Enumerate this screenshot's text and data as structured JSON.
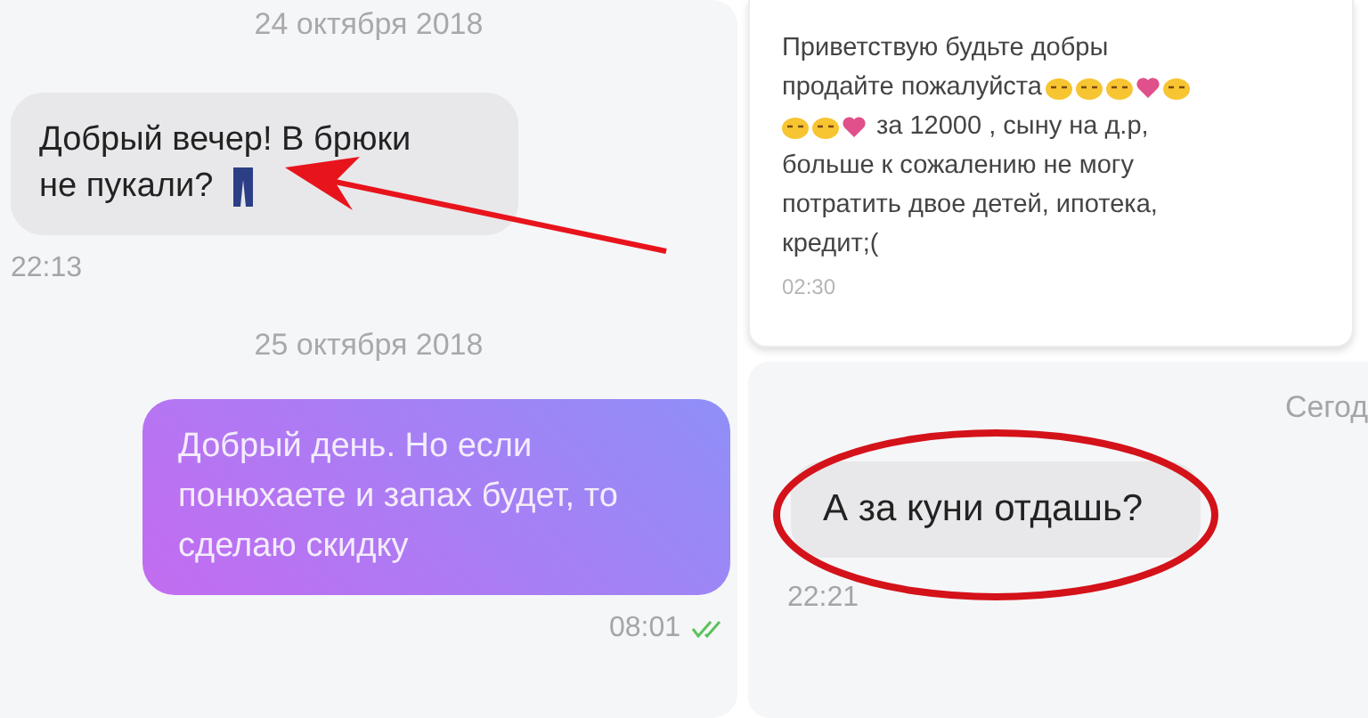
{
  "left_chat": {
    "items": [
      {
        "kind": "date",
        "text": "24 октября 2018"
      },
      {
        "kind": "incoming",
        "lines": [
          "Добрый вечер! В брюки",
          "не пукали?"
        ],
        "emoji": [
          {
            "kind": "trousers"
          }
        ],
        "time": "22:13",
        "annotated": true
      },
      {
        "kind": "date",
        "text": "25 октября 2018"
      },
      {
        "kind": "outgoing",
        "text": "Добрый день. Но если понюхаете и запах будет, то сделаю скидку",
        "time": "08:01",
        "read": true
      }
    ]
  },
  "right_top_chat": {
    "message": {
      "lines": [
        {
          "text": "Приветствую будьте добры"
        },
        {
          "text": "продайте пожалуйста",
          "emoji_after": [
            {
              "kind": "face"
            },
            {
              "kind": "face"
            },
            {
              "kind": "face"
            },
            {
              "kind": "heart"
            },
            {
              "kind": "face"
            }
          ]
        },
        {
          "emoji_before": [
            {
              "kind": "face"
            },
            {
              "kind": "face"
            },
            {
              "kind": "heart"
            }
          ],
          "text": "за 12000 , сыну на д.р,"
        },
        {
          "text": "больше к сожалению не могу потратить двое детей, ипотека, кредит;("
        }
      ],
      "time": "02:30"
    }
  },
  "right_bottom_chat": {
    "date": "Сегод",
    "message": {
      "text": "А за куни отдашь?",
      "time": "22:21",
      "circled": true
    }
  }
}
